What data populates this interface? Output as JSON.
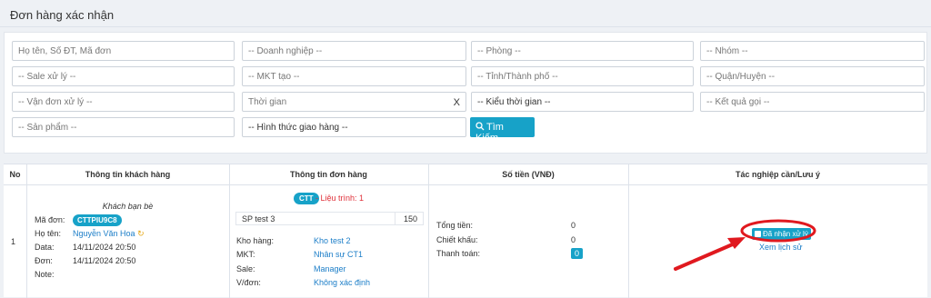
{
  "page_title": "Đơn hàng xác nhận",
  "filters": {
    "row1": [
      "Họ tên, Số ĐT, Mã đơn",
      "-- Doanh nghiệp --",
      "-- Phòng --",
      "-- Nhóm --"
    ],
    "row2": [
      "-- Sale xử lý --",
      "-- MKT tạo --",
      "-- Tỉnh/Thành phố --",
      "-- Quận/Huyện --"
    ],
    "row3": [
      "-- Vận đơn xử lý --",
      "Thời gian",
      "-- Kiểu thời gian --",
      "-- Kết quả gọi --"
    ],
    "row4": [
      "-- Sản phẩm --",
      "-- Hình thức giao hàng --"
    ],
    "time_clear": "X",
    "search_button": "Tìm Kiếm"
  },
  "table": {
    "headers": [
      "No",
      "Thông tin khách hàng",
      "Thông tin đơn hàng",
      "Số tiền (VNĐ)",
      "Tác nghiệp cần/Lưu ý"
    ],
    "row": {
      "no": "1",
      "customer": {
        "group": "Khách bạn bè",
        "order_code_label": "Mã đơn:",
        "order_code": "CTTPIU9C8",
        "name_label": "Họ tên:",
        "name": "Nguyễn Văn Hoa",
        "data_label": "Data:",
        "data_time": "14/11/2024 20:50",
        "order_label": "Đơn:",
        "order_time": "14/11/2024 20:50",
        "note_label": "Note:"
      },
      "order": {
        "badge": "CTT",
        "route": "- Liệu trình: 1",
        "product": "SP test 3",
        "qty": "150",
        "warehouse_label": "Kho hàng:",
        "warehouse": "Kho test 2",
        "mkt_label": "MKT:",
        "mkt": "Nhân sự CT1",
        "sale_label": "Sale:",
        "sale": "Manager",
        "shipping_label": "V/đơn:",
        "shipping": "Không xác định"
      },
      "money": {
        "total_label": "Tổng tiền:",
        "total": "0",
        "discount_label": "Chiết khấu:",
        "discount": "0",
        "payment_label": "Thanh toán:",
        "payment": "0"
      },
      "action": {
        "status": "Đã nhận xử lý",
        "history": "Xem lịch sử"
      }
    }
  },
  "colors": {
    "accent": "#17a2c8",
    "link": "#1c7ec8",
    "annotation": "#e0191f"
  }
}
